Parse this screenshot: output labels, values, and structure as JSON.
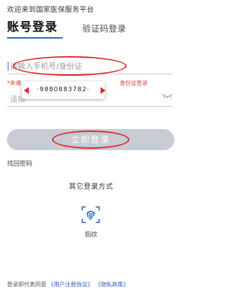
{
  "header": {
    "welcome": "欢迎来到国家医保服务平台",
    "tab_active": "账号登录",
    "tab_inactive": "验证码登录"
  },
  "form": {
    "account_placeholder": "请输入手机号/身份证",
    "hint_left": "*未诸",
    "hint_right": "身份证登录",
    "password_placeholder": "请输",
    "popup_value": "·9880883782·"
  },
  "actions": {
    "login_button": "立即登录",
    "forgot_password": "找回密码",
    "other_methods": "其它登录方式",
    "fingerprint_label": "指纹"
  },
  "footer": {
    "prefix": "登录即代表同意",
    "user_agreement": "《用户注册协议》",
    "privacy_policy": "《隐私政策》"
  },
  "colors": {
    "accent": "#2a62c9",
    "annotation_red": "#e32a2a",
    "button_disabled": "#c7cbd3"
  }
}
